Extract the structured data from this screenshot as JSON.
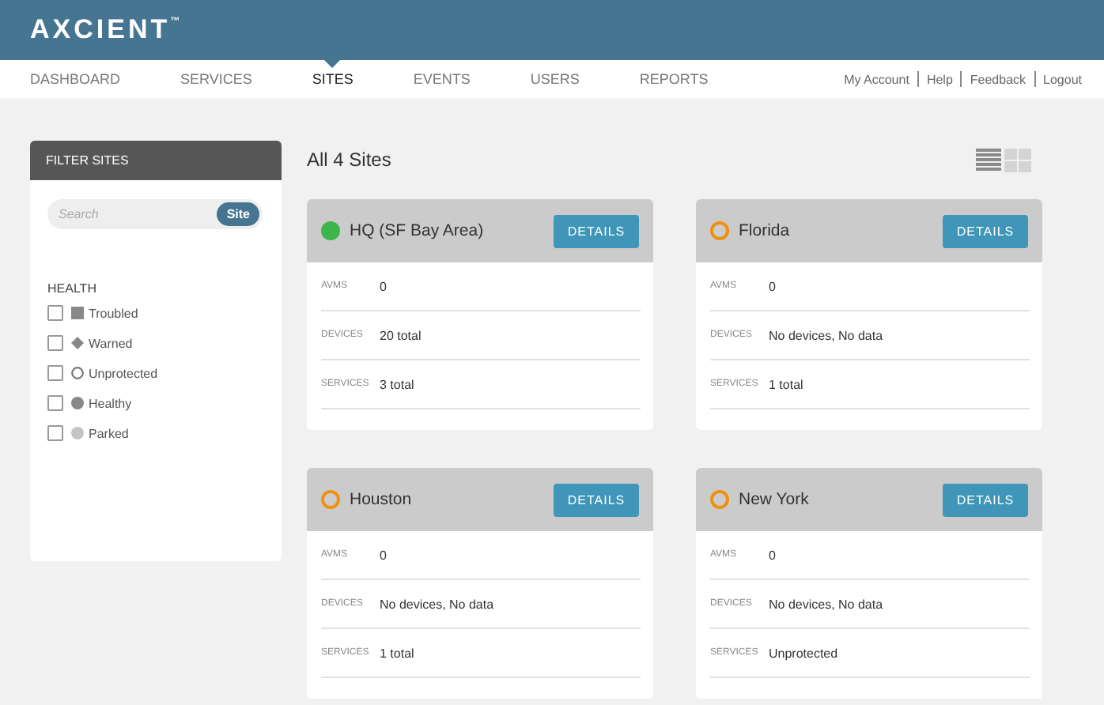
{
  "header": {
    "logo": "AXCIENT",
    "trademark": "™"
  },
  "nav": {
    "tabs": [
      {
        "label": "DASHBOARD",
        "selected": false
      },
      {
        "label": "SERVICES",
        "selected": false
      },
      {
        "label": "SITES",
        "selected": true
      },
      {
        "label": "EVENTS",
        "selected": false
      },
      {
        "label": "USERS",
        "selected": false
      },
      {
        "label": "REPORTS",
        "selected": false
      }
    ],
    "account_links": [
      "My Account",
      "Help",
      "Feedback",
      "Logout"
    ]
  },
  "sidebar": {
    "title": "FILTER SITES",
    "search": {
      "placeholder": "Search",
      "button": "Site"
    },
    "health": {
      "heading": "HEALTH",
      "items": [
        {
          "label": "Troubled",
          "kind": "square",
          "checked": false
        },
        {
          "label": "Warned",
          "kind": "diamond",
          "checked": false
        },
        {
          "label": "Unprotected",
          "kind": "ring",
          "checked": false
        },
        {
          "label": "Healthy",
          "kind": "dot",
          "checked": false
        },
        {
          "label": "Parked",
          "kind": "light-dot",
          "checked": false
        }
      ]
    }
  },
  "main": {
    "title": "All 4 Sites",
    "views": [
      {
        "kind": "list",
        "selected": true
      },
      {
        "kind": "grid",
        "selected": false
      }
    ],
    "sites": [
      {
        "name": "HQ (SF Bay Area)",
        "kind": "filled",
        "color": "#3db54a",
        "button": "DETAILS",
        "rows": [
          {
            "label": "AVMS",
            "value": "0"
          },
          {
            "label": "DEVICES",
            "value": "20 total"
          },
          {
            "label": "SERVICES",
            "value": "3 total"
          }
        ]
      },
      {
        "name": "Florida",
        "kind": "ring",
        "color": "#f0900f",
        "button": "DETAILS",
        "rows": [
          {
            "label": "AVMS",
            "value": "0"
          },
          {
            "label": "DEVICES",
            "value": "No devices, No data"
          },
          {
            "label": "SERVICES",
            "value": "1 total"
          }
        ]
      },
      {
        "name": "Houston",
        "kind": "ring",
        "color": "#f0900f",
        "button": "DETAILS",
        "rows": [
          {
            "label": "AVMS",
            "value": "0"
          },
          {
            "label": "DEVICES",
            "value": "No devices, No data"
          },
          {
            "label": "SERVICES",
            "value": "1 total"
          }
        ]
      },
      {
        "name": "New York",
        "kind": "ring",
        "color": "#f0900f",
        "button": "DETAILS",
        "rows": [
          {
            "label": "AVMS",
            "value": "0"
          },
          {
            "label": "DEVICES",
            "value": "No devices, No data"
          },
          {
            "label": "SERVICES",
            "value": "Unprotected"
          }
        ]
      }
    ]
  }
}
